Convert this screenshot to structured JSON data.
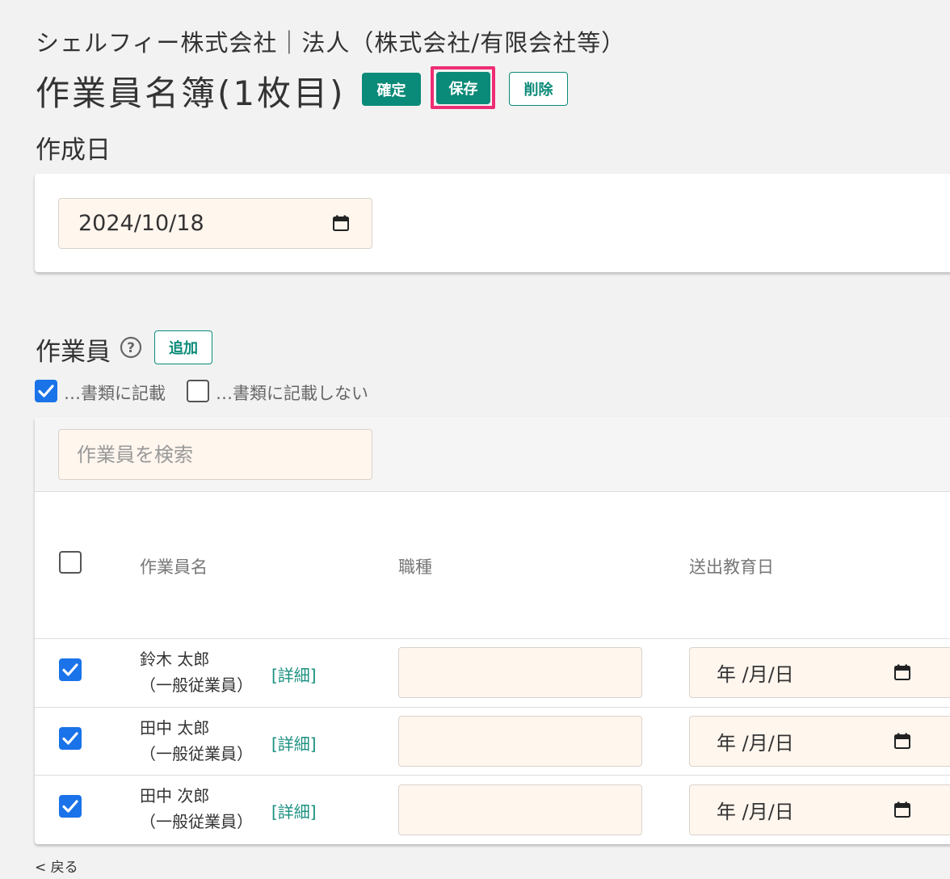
{
  "header": {
    "company": "シェルフィー株式会社｜法人（株式会社/有限会社等）",
    "title": "作業員名簿(1枚目)",
    "confirm_label": "確定",
    "save_label": "保存",
    "delete_label": "削除"
  },
  "creation": {
    "label": "作成日",
    "date_value": "2024/10/18"
  },
  "workers": {
    "label": "作業員",
    "add_label": "追加",
    "filter_include": "…書類に記載",
    "filter_exclude": "…書類に記載しない",
    "search_placeholder": "作業員を検索",
    "columns": {
      "name": "作業員名",
      "job": "職種",
      "education_date": "送出教育日"
    },
    "rows": [
      {
        "name": "鈴木 太郎",
        "role": "（一般従業員）",
        "detail": "[詳細]",
        "date": "年 /月/日"
      },
      {
        "name": "田中 太郎",
        "role": "（一般従業員）",
        "detail": "[詳細]",
        "date": "年 /月/日"
      },
      {
        "name": "田中 次郎",
        "role": "（一般従業員）",
        "detail": "[詳細]",
        "date": "年 /月/日"
      }
    ]
  },
  "footer": {
    "back_label": "< 戻る"
  },
  "colors": {
    "accent": "#0a8a78",
    "highlight": "#ee2d74",
    "checkbox": "#1a73e8",
    "input_bg": "#fff6ee"
  },
  "icons": [
    "calendar-icon",
    "help-icon",
    "checkmark-icon"
  ]
}
